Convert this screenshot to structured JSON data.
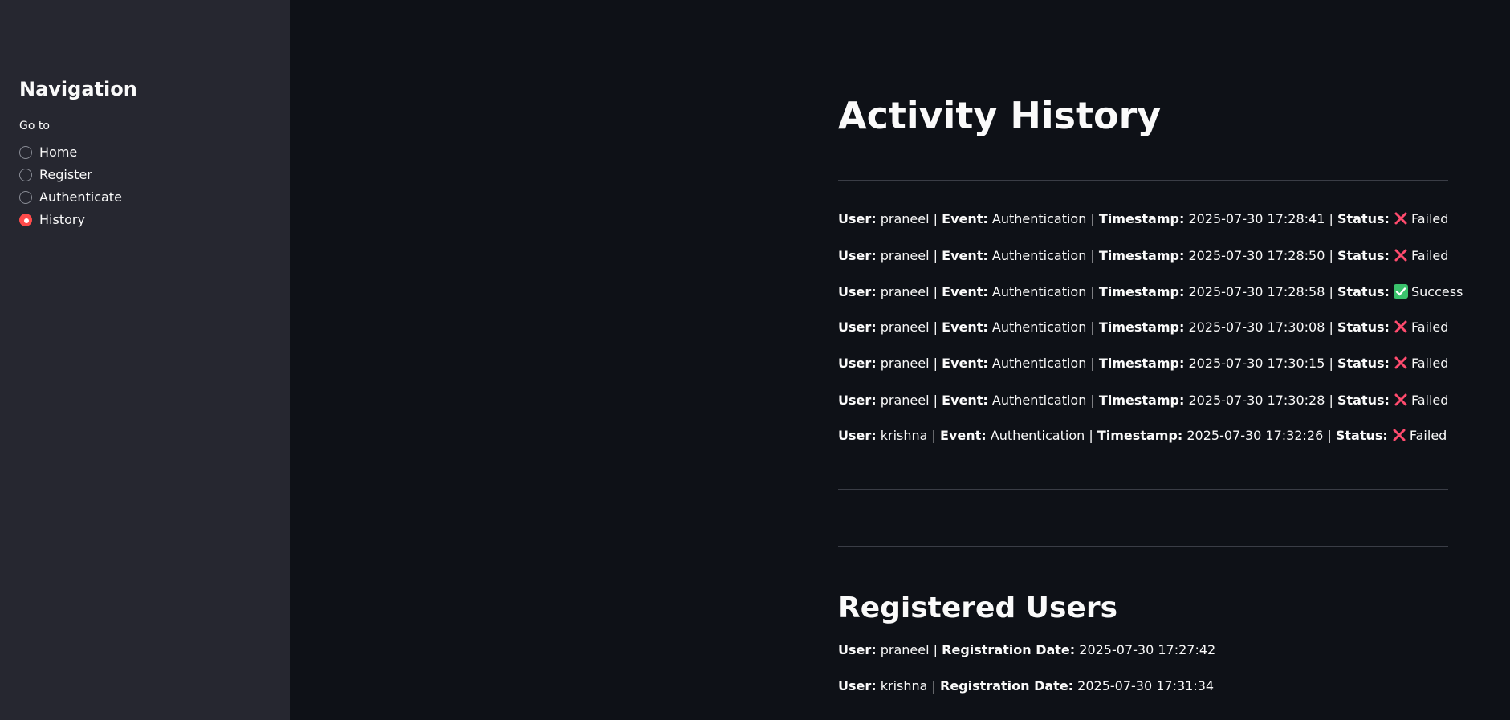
{
  "sidebar": {
    "title": "Navigation",
    "radio_label": "Go to",
    "items": [
      {
        "label": "Home",
        "selected": false
      },
      {
        "label": "Register",
        "selected": false
      },
      {
        "label": "Authenticate",
        "selected": false
      },
      {
        "label": "History",
        "selected": true
      }
    ]
  },
  "main": {
    "title": "Activity History",
    "field_labels": {
      "user": "User:",
      "event": "Event:",
      "timestamp": "Timestamp:",
      "status": "Status:",
      "registration_date": "Registration Date:"
    },
    "separator": "|",
    "activity": [
      {
        "user": "praneel",
        "event": "Authentication",
        "timestamp": "2025-07-30 17:28:41",
        "status": "Failed",
        "status_icon": "cross-mark-icon"
      },
      {
        "user": "praneel",
        "event": "Authentication",
        "timestamp": "2025-07-30 17:28:50",
        "status": "Failed",
        "status_icon": "cross-mark-icon"
      },
      {
        "user": "praneel",
        "event": "Authentication",
        "timestamp": "2025-07-30 17:28:58",
        "status": "Success",
        "status_icon": "check-mark-icon"
      },
      {
        "user": "praneel",
        "event": "Authentication",
        "timestamp": "2025-07-30 17:30:08",
        "status": "Failed",
        "status_icon": "cross-mark-icon"
      },
      {
        "user": "praneel",
        "event": "Authentication",
        "timestamp": "2025-07-30 17:30:15",
        "status": "Failed",
        "status_icon": "cross-mark-icon"
      },
      {
        "user": "praneel",
        "event": "Authentication",
        "timestamp": "2025-07-30 17:30:28",
        "status": "Failed",
        "status_icon": "cross-mark-icon"
      },
      {
        "user": "krishna",
        "event": "Authentication",
        "timestamp": "2025-07-30 17:32:26",
        "status": "Failed",
        "status_icon": "cross-mark-icon"
      }
    ],
    "registered_title": "Registered Users",
    "registered": [
      {
        "user": "praneel",
        "date": "2025-07-30 17:27:42"
      },
      {
        "user": "krishna",
        "date": "2025-07-30 17:31:34"
      }
    ]
  },
  "colors": {
    "background": "#0e1117",
    "sidebar": "#262730",
    "accent": "#ff4b4b",
    "failed": "#ff4b6e",
    "success": "#3ac26c",
    "divider": "#3a3d46"
  }
}
